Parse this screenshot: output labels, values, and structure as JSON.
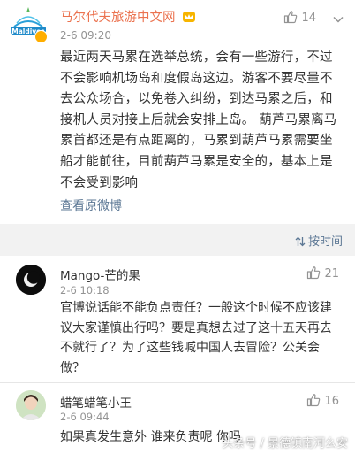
{
  "post": {
    "author": "马尔代夫旅游中文网",
    "avatar_text": "Maldives",
    "time": "2-6 09:20",
    "like_count": "14",
    "body": "最近两天马累在选举总统，会有一些游行，不过不会影响机场岛和度假岛这边。游客不要尽量不去公众场合，以免卷入纠纷，到达马累之后，和接机人员对接上后就会安排上岛。 葫芦马累离马累首都还是有点距离的，马累到葫芦马累需要坐船才能前往，目前葫芦马累是安全的，基本上是不会受到影响",
    "view_original": "查看原微博"
  },
  "comments_header": {
    "sort_label": "按时间"
  },
  "comments": [
    {
      "name": "Mango-芒的果",
      "time": "2-6 10:18",
      "likes": "21",
      "text": "官博说话能不能负点责任？一般这个时候不应该建议大家谨慎出行吗？要是真想去过了这十五天再去不就行了？为了这些钱喊中国人去冒险？公关会做？"
    },
    {
      "name": "蜡笔蜡笔小王",
      "time": "2-6 09:44",
      "likes": "16",
      "text": "如果真发生意外 谁来负责呢 你吗"
    }
  ],
  "watermark": "头条号 / 景德镇南河么安",
  "colors": {
    "author": "#eb7350",
    "link": "#5d7895",
    "meta": "#939393",
    "gap": "#f2f2f2"
  },
  "icons": [
    "like-icon",
    "more-chevron-icon",
    "sort-icon",
    "crown-badge-icon",
    "verified-badge-icon"
  ]
}
